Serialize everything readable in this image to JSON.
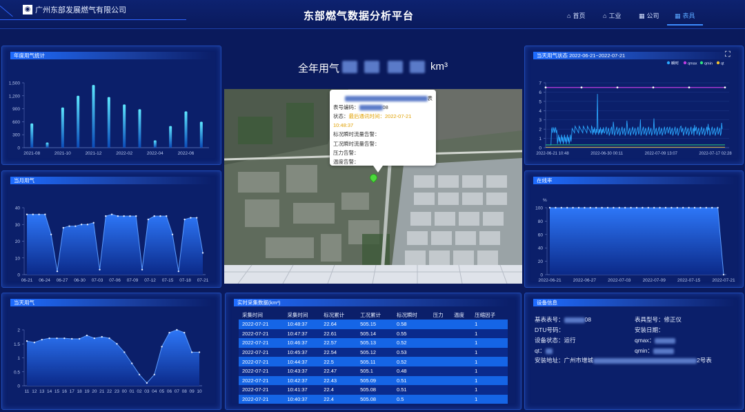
{
  "header": {
    "company": "广州东部发展燃气有限公司",
    "title": "东部燃气数据分析平台",
    "nav": [
      {
        "icon": "⌂",
        "label": "首页"
      },
      {
        "icon": "⌂",
        "label": "工业"
      },
      {
        "icon": "▦",
        "label": "公司"
      },
      {
        "icon": "▦",
        "label": "表具"
      }
    ]
  },
  "panels": {
    "annual": "年度用气统计",
    "monthly": "当月用气",
    "daily": "当天用气",
    "status": "当天用气状态 2022-06-21~2022-07-21",
    "online": "在线率",
    "realtime": "实时采集数据(km³)",
    "device": "设备信息"
  },
  "center": {
    "title": "全年用气",
    "unit": "km³"
  },
  "popup": {
    "title": "表",
    "lines": [
      {
        "label": "表号编码：",
        "value": "08"
      },
      {
        "label": "状态：",
        "value": "最后通讯时间：2022-07-21 10:48:37"
      },
      {
        "label": "标况瞬时流量告警：",
        "value": ""
      },
      {
        "label": "工况瞬时流量告警：",
        "value": ""
      },
      {
        "label": "压力告警：",
        "value": ""
      },
      {
        "label": "温度告警：",
        "value": ""
      }
    ]
  },
  "table": {
    "headers": [
      "采集时间",
      "采集时间",
      "标况累计",
      "工况累计",
      "标况瞬时",
      "压力",
      "温度",
      "压缩因子"
    ],
    "rows": [
      [
        "2022-07-21",
        "10:48:37",
        "22.64",
        "505.15",
        "0.58",
        "",
        "",
        "1"
      ],
      [
        "2022-07-21",
        "10:47:37",
        "22.61",
        "505.14",
        "0.55",
        "",
        "",
        "1"
      ],
      [
        "2022-07-21",
        "10:46:37",
        "22.57",
        "505.13",
        "0.52",
        "",
        "",
        "1"
      ],
      [
        "2022-07-21",
        "10:45:37",
        "22.54",
        "505.12",
        "0.53",
        "",
        "",
        "1"
      ],
      [
        "2022-07-21",
        "10:44:37",
        "22.5",
        "505.11",
        "0.52",
        "",
        "",
        "1"
      ],
      [
        "2022-07-21",
        "10:43:37",
        "22.47",
        "505.1",
        "0.48",
        "",
        "",
        "1"
      ],
      [
        "2022-07-21",
        "10:42:37",
        "22.43",
        "505.09",
        "0.51",
        "",
        "",
        "1"
      ],
      [
        "2022-07-21",
        "10:41:37",
        "22.4",
        "505.08",
        "0.51",
        "",
        "",
        "1"
      ],
      [
        "2022-07-21",
        "10:40:37",
        "22.4",
        "505.08",
        "0.5",
        "",
        "",
        "1"
      ]
    ]
  },
  "device": {
    "meter_no": "基表表号：",
    "meter_no_val": "08",
    "model": "表具型号：修正仪",
    "dtu": "DTU号码：",
    "install_date": "安装日期：",
    "status": "设备状态：运行",
    "qmax": "qmax：",
    "qt": "qt：",
    "qmin": "qmin：",
    "address": "安装地址：广州市增城",
    "address_tail": "2号表"
  },
  "chart_data": [
    {
      "type": "bar",
      "title": "年度用气统计",
      "categories": [
        "2021-08",
        "2021-09",
        "2021-10",
        "2021-11",
        "2021-12",
        "2022-01",
        "2022-02",
        "2022-03",
        "2022-04",
        "2022-05",
        "2022-06",
        "2022-07"
      ],
      "x_tick_labels": [
        "2021-08",
        "2021-10",
        "2021-12",
        "2022-02",
        "2022-04",
        "2022-06"
      ],
      "values": [
        560,
        120,
        930,
        1200,
        1450,
        1170,
        1000,
        890,
        170,
        500,
        840,
        600
      ],
      "ylim": [
        0,
        1500
      ],
      "y_ticks": [
        "0",
        "300",
        "600",
        "900",
        "1,200",
        "1,500"
      ]
    },
    {
      "type": "area",
      "title": "当月用气",
      "x_tick_labels": [
        "06-21",
        "06-24",
        "06-27",
        "06-30",
        "07-03",
        "07-06",
        "07-09",
        "07-12",
        "07-15",
        "07-18",
        "07-21"
      ],
      "values": [
        36,
        36,
        36,
        36,
        24,
        2,
        28,
        29,
        29,
        30,
        30,
        31,
        3,
        35,
        36,
        35,
        35,
        35,
        35,
        3,
        33,
        35,
        35,
        35,
        24,
        2,
        33,
        34,
        34,
        13
      ],
      "ylim": [
        0,
        40
      ],
      "y_ticks": [
        "0",
        "10",
        "20",
        "30",
        "40"
      ]
    },
    {
      "type": "area",
      "title": "当天用气",
      "x_tick_labels": [
        "11",
        "12",
        "13",
        "14",
        "15",
        "16",
        "17",
        "18",
        "19",
        "20",
        "21",
        "22",
        "23",
        "00",
        "01",
        "02",
        "03",
        "04",
        "05",
        "06",
        "07",
        "08",
        "09",
        "10"
      ],
      "values": [
        1.6,
        1.55,
        1.65,
        1.7,
        1.7,
        1.7,
        1.68,
        1.68,
        1.8,
        1.7,
        1.75,
        1.7,
        1.5,
        1.2,
        0.8,
        0.4,
        0.1,
        0.4,
        1.4,
        1.9,
        2.0,
        1.9,
        1.2,
        1.2
      ],
      "ylim": [
        0,
        2
      ],
      "y_ticks": [
        "0",
        "0.5",
        "1",
        "1.5",
        "2"
      ]
    },
    {
      "type": "line",
      "title": "当天用气状态",
      "legend": [
        "瞬时",
        "qmax",
        "qmin",
        "qt"
      ],
      "legend_colors": [
        "#2aa7ff",
        "#c03ce0",
        "#30e080",
        "#f0c030"
      ],
      "x_tick_labels": [
        "2022-06-21 10:48",
        "2022-06-30 00:11",
        "2022-07-09 13:07",
        "2022-07-17 02:28"
      ],
      "ylim": [
        0,
        7
      ],
      "y_ticks": [
        "0",
        "1",
        "2",
        "3",
        "4",
        "5",
        "6",
        "7"
      ],
      "qmax": 6.5,
      "qmin": 0.3
    },
    {
      "type": "area",
      "title": "在线率",
      "ylabel": "%",
      "x_tick_labels": [
        "2022-06-21",
        "2022-06-27",
        "2022-07-03",
        "2022-07-09",
        "2022-07-15",
        "2022-07-21"
      ],
      "values": [
        100,
        100,
        100,
        100,
        100,
        100,
        100,
        100,
        100,
        100,
        100,
        100,
        100,
        100,
        100,
        100,
        100,
        100,
        100,
        100,
        100,
        100,
        100,
        100,
        100,
        100,
        100,
        100,
        100,
        100,
        0
      ],
      "ylim": [
        0,
        100
      ],
      "y_ticks": [
        "0",
        "20",
        "40",
        "60",
        "80",
        "100"
      ]
    }
  ]
}
